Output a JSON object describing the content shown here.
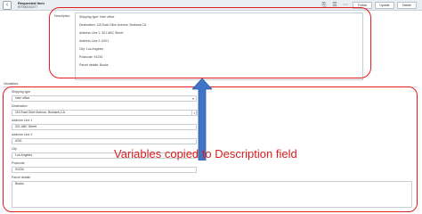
{
  "header": {
    "title": "Requested Item",
    "subtitle": "RITM0010477",
    "buttons": [
      "Follow",
      "Update",
      "Delete"
    ],
    "icons": [
      "paperclip-icon",
      "settings-icon",
      "more-icon"
    ]
  },
  "description": {
    "label": "Description",
    "lines": [
      "Shipping type: Inter office",
      "Destination: 115 East Olive Avenue, Burbank,CA",
      "Address Line 1: 321 ABC Street",
      "Address Line 2: #201",
      "City: Los Angeles",
      "Postcode: 91234",
      "Parcel details: Books"
    ]
  },
  "variables": {
    "title": "Variables",
    "fields": [
      {
        "label": "Shipping type",
        "value": "Inter office",
        "kind": "select"
      },
      {
        "label": "Destination",
        "value": "115 East Olive Avenue, Burbank,CA",
        "kind": "lookup"
      },
      {
        "label": "Address Line 1",
        "value": "321 ABC Street",
        "kind": "text"
      },
      {
        "label": "Address Line 2",
        "value": "#201",
        "kind": "text"
      },
      {
        "label": "City",
        "value": "Los Angeles",
        "kind": "text"
      },
      {
        "label": "Postcode",
        "value": "91234",
        "kind": "text"
      },
      {
        "label": "Parcel details",
        "value": "Books",
        "kind": "text"
      }
    ]
  },
  "annotation": {
    "caption": "Variables copied to Description field",
    "color": "#d81e1e",
    "arrow_color": "#3f74c7"
  }
}
